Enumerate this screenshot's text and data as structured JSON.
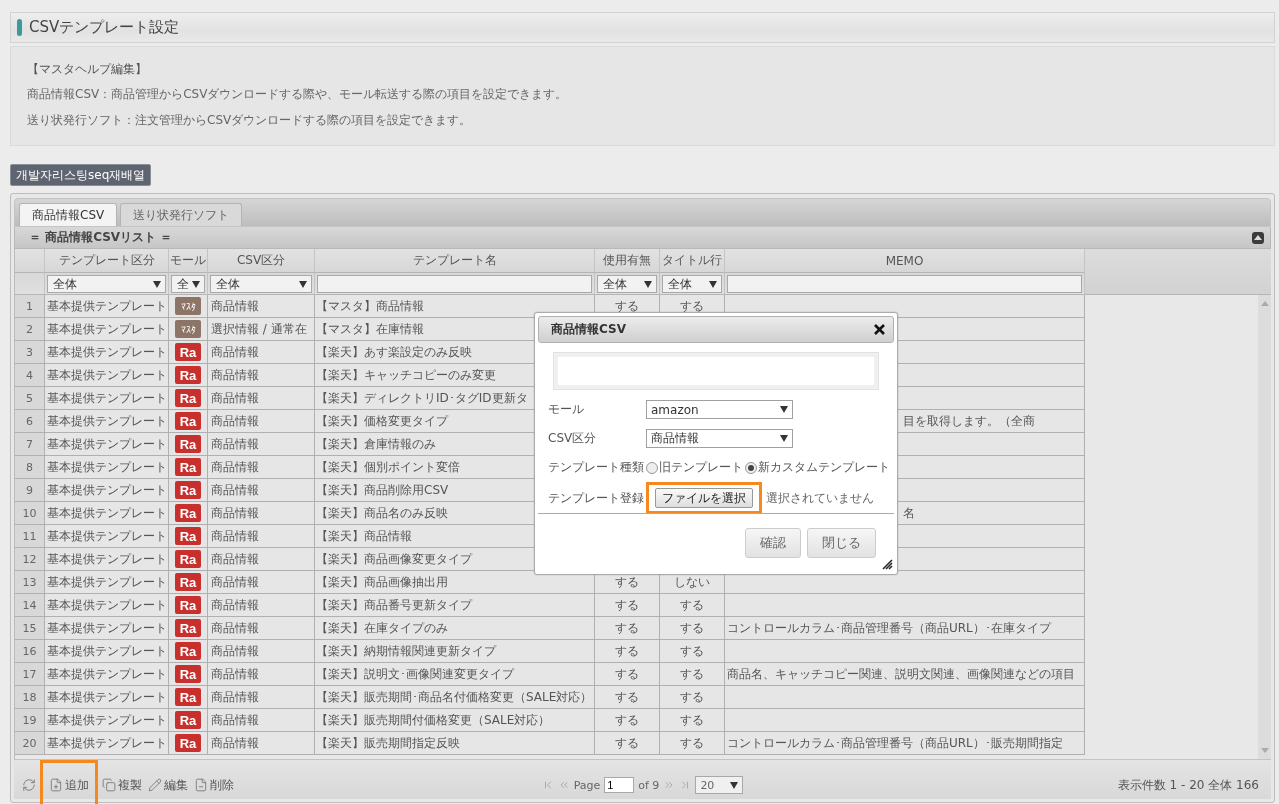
{
  "page_title": "CSVテンプレート設定",
  "help": {
    "heading": "【マスタヘルプ編集】",
    "lines": [
      "商品情報CSV：商品管理からCSVダウンロードする際や、モール転送する際の項目を設定できます。",
      "送り状発行ソフト：注文管理からCSVダウンロードする際の項目を設定できます。"
    ]
  },
  "action_button": "개발자리스팅seq재배열",
  "tabs": [
    {
      "label": "商品情報CSV",
      "selected": true
    },
    {
      "label": "送り状発行ソフト",
      "selected": false
    }
  ],
  "grid": {
    "caption": "＝ 商品情報CSVリスト ＝",
    "columns": [
      "テンプレート区分",
      "モール",
      "CSV区分",
      "テンプレート名",
      "使用有無",
      "タイトル行",
      "MEMO"
    ],
    "filters": [
      {
        "kind": "select",
        "value": "全体"
      },
      {
        "kind": "select",
        "value": "全"
      },
      {
        "kind": "select",
        "value": "全体"
      },
      {
        "kind": "text"
      },
      {
        "kind": "select",
        "value": "全体"
      },
      {
        "kind": "select",
        "value": "全体"
      },
      {
        "kind": "text"
      }
    ],
    "rows": [
      {
        "no": "1",
        "category": "基本提供テンプレート",
        "mall": {
          "kind": "master",
          "label": "ﾏｽﾀ"
        },
        "csv_type": "商品情報",
        "name": "【マスタ】商品情報",
        "usage": "する",
        "title_row": "する"
      },
      {
        "no": "2",
        "category": "基本提供テンプレート",
        "mall": {
          "kind": "master",
          "label": "ﾏｽﾀ"
        },
        "csv_type": "選択情報 / 通常在",
        "name": "【マスタ】在庫情報"
      },
      {
        "no": "3",
        "category": "基本提供テンプレート",
        "mall": {
          "kind": "rakuten",
          "label": "Ra"
        },
        "csv_type": "商品情報",
        "name": "【楽天】あす楽設定のみ反映"
      },
      {
        "no": "4",
        "category": "基本提供テンプレート",
        "mall": {
          "kind": "rakuten",
          "label": "Ra"
        },
        "csv_type": "商品情報",
        "name": "【楽天】キャッチコピーのみ変更"
      },
      {
        "no": "5",
        "category": "基本提供テンプレート",
        "mall": {
          "kind": "rakuten",
          "label": "Ra"
        },
        "csv_type": "商品情報",
        "name": "【楽天】ディレクトリID･タグID更新タ"
      },
      {
        "no": "6",
        "category": "基本提供テンプレート",
        "mall": {
          "kind": "rakuten",
          "label": "Ra"
        },
        "csv_type": "商品情報",
        "name": "【楽天】価格変更タイプ",
        "memo": "目を取得します。（全商",
        "memo_partial": true
      },
      {
        "no": "7",
        "category": "基本提供テンプレート",
        "mall": {
          "kind": "rakuten",
          "label": "Ra"
        },
        "csv_type": "商品情報",
        "name": "【楽天】倉庫情報のみ"
      },
      {
        "no": "8",
        "category": "基本提供テンプレート",
        "mall": {
          "kind": "rakuten",
          "label": "Ra"
        },
        "csv_type": "商品情報",
        "name": "【楽天】個別ポイント変倍"
      },
      {
        "no": "9",
        "category": "基本提供テンプレート",
        "mall": {
          "kind": "rakuten",
          "label": "Ra"
        },
        "csv_type": "商品情報",
        "name": "【楽天】商品削除用CSV"
      },
      {
        "no": "10",
        "category": "基本提供テンプレート",
        "mall": {
          "kind": "rakuten",
          "label": "Ra"
        },
        "csv_type": "商品情報",
        "name": "【楽天】商品名のみ反映",
        "memo": "名",
        "memo_partial": true
      },
      {
        "no": "11",
        "category": "基本提供テンプレート",
        "mall": {
          "kind": "rakuten",
          "label": "Ra"
        },
        "csv_type": "商品情報",
        "name": "【楽天】商品情報"
      },
      {
        "no": "12",
        "category": "基本提供テンプレート",
        "mall": {
          "kind": "rakuten",
          "label": "Ra"
        },
        "csv_type": "商品情報",
        "name": "【楽天】商品画像変更タイプ"
      },
      {
        "no": "13",
        "category": "基本提供テンプレート",
        "mall": {
          "kind": "rakuten",
          "label": "Ra"
        },
        "csv_type": "商品情報",
        "name": "【楽天】商品画像抽出用",
        "usage": "する",
        "title_row": "しない"
      },
      {
        "no": "14",
        "category": "基本提供テンプレート",
        "mall": {
          "kind": "rakuten",
          "label": "Ra"
        },
        "csv_type": "商品情報",
        "name": "【楽天】商品番号更新タイプ",
        "usage": "する",
        "title_row": "する"
      },
      {
        "no": "15",
        "category": "基本提供テンプレート",
        "mall": {
          "kind": "rakuten",
          "label": "Ra"
        },
        "csv_type": "商品情報",
        "name": "【楽天】在庫タイプのみ",
        "usage": "する",
        "title_row": "する",
        "memo": "コントロールカラム･商品管理番号（商品URL）･在庫タイプ"
      },
      {
        "no": "16",
        "category": "基本提供テンプレート",
        "mall": {
          "kind": "rakuten",
          "label": "Ra"
        },
        "csv_type": "商品情報",
        "name": "【楽天】納期情報関連更新タイプ",
        "usage": "する",
        "title_row": "する"
      },
      {
        "no": "17",
        "category": "基本提供テンプレート",
        "mall": {
          "kind": "rakuten",
          "label": "Ra"
        },
        "csv_type": "商品情報",
        "name": "【楽天】説明文･画像関連変更タイプ",
        "usage": "する",
        "title_row": "する",
        "memo": "商品名、キャッチコピー関連、説明文関連、画像関連などの項目"
      },
      {
        "no": "18",
        "category": "基本提供テンプレート",
        "mall": {
          "kind": "rakuten",
          "label": "Ra"
        },
        "csv_type": "商品情報",
        "name": "【楽天】販売期間･商品名付価格変更（SALE対応）",
        "usage": "する",
        "title_row": "する"
      },
      {
        "no": "19",
        "category": "基本提供テンプレート",
        "mall": {
          "kind": "rakuten",
          "label": "Ra"
        },
        "csv_type": "商品情報",
        "name": "【楽天】販売期間付価格変更（SALE対応）",
        "usage": "する",
        "title_row": "する"
      },
      {
        "no": "20",
        "category": "基本提供テンプレート",
        "mall": {
          "kind": "rakuten",
          "label": "Ra"
        },
        "csv_type": "商品情報",
        "name": "【楽天】販売期間指定反映",
        "usage": "する",
        "title_row": "する",
        "memo": "コントロールカラム･商品管理番号（商品URL）･販売期間指定"
      }
    ]
  },
  "toolbar": [
    {
      "kind": "refresh"
    },
    {
      "kind": "add",
      "label": "追加",
      "highlighted": true
    },
    {
      "kind": "copy",
      "label": "複製",
      "highlighted": false
    },
    {
      "kind": "edit",
      "label": "編集",
      "highlighted": false
    },
    {
      "kind": "delete",
      "label": "削除",
      "highlighted": false
    }
  ],
  "pager": {
    "page_label": "Page",
    "page": "1",
    "of": "of 9",
    "page_size": "20",
    "summary": "表示件数 1 - 20 全体 166"
  },
  "dialog": {
    "title": "商品情報CSV",
    "fields": [
      {
        "kind": "select",
        "label": "モール",
        "value": "amazon"
      },
      {
        "kind": "select",
        "label": "CSV区分",
        "value": "商品情報"
      },
      {
        "kind": "radio",
        "label": "テンプレート種類",
        "options": [
          {
            "label": "旧テンプレート",
            "selected": false
          },
          {
            "label": "新カスタムテンプレート",
            "selected": true
          }
        ]
      },
      {
        "kind": "file",
        "label": "テンプレート登録",
        "button": "ファイルを選択",
        "status": "選択されていません",
        "highlighted": true
      }
    ],
    "buttons": [
      "確認",
      "閉じる"
    ]
  }
}
